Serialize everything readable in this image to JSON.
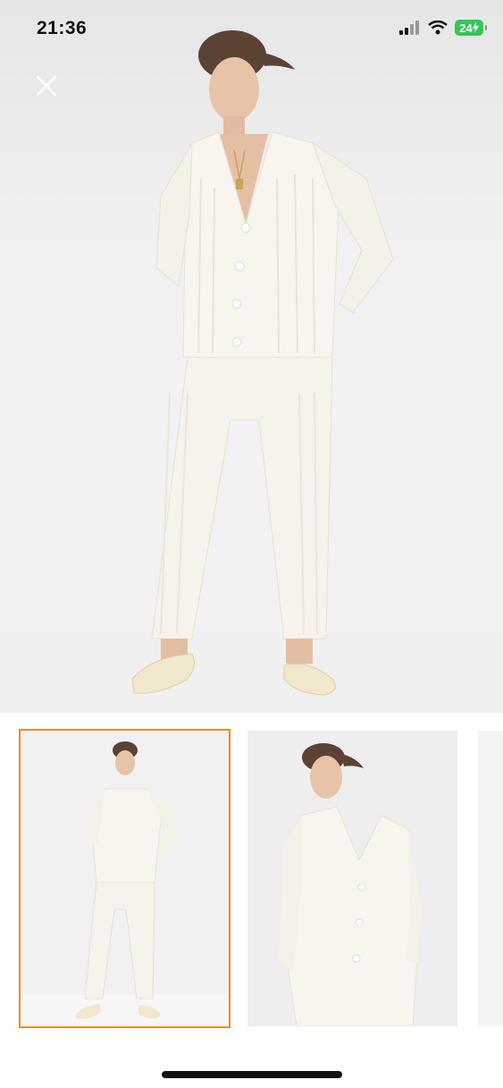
{
  "status_bar": {
    "time": "21:36",
    "battery": "24",
    "icons": [
      "signal-icon",
      "wifi-icon",
      "battery-charging-icon"
    ]
  },
  "toolbar": {
    "close_icon": "close-icon"
  },
  "gallery": {
    "main_image": "product-photo-model-front",
    "thumbnails": [
      {
        "name": "thumbnail-front-full",
        "selected": true
      },
      {
        "name": "thumbnail-leaning-wall",
        "selected": false
      },
      {
        "name": "thumbnail-partial",
        "selected": false
      }
    ],
    "accent_color": "#f08a24"
  }
}
